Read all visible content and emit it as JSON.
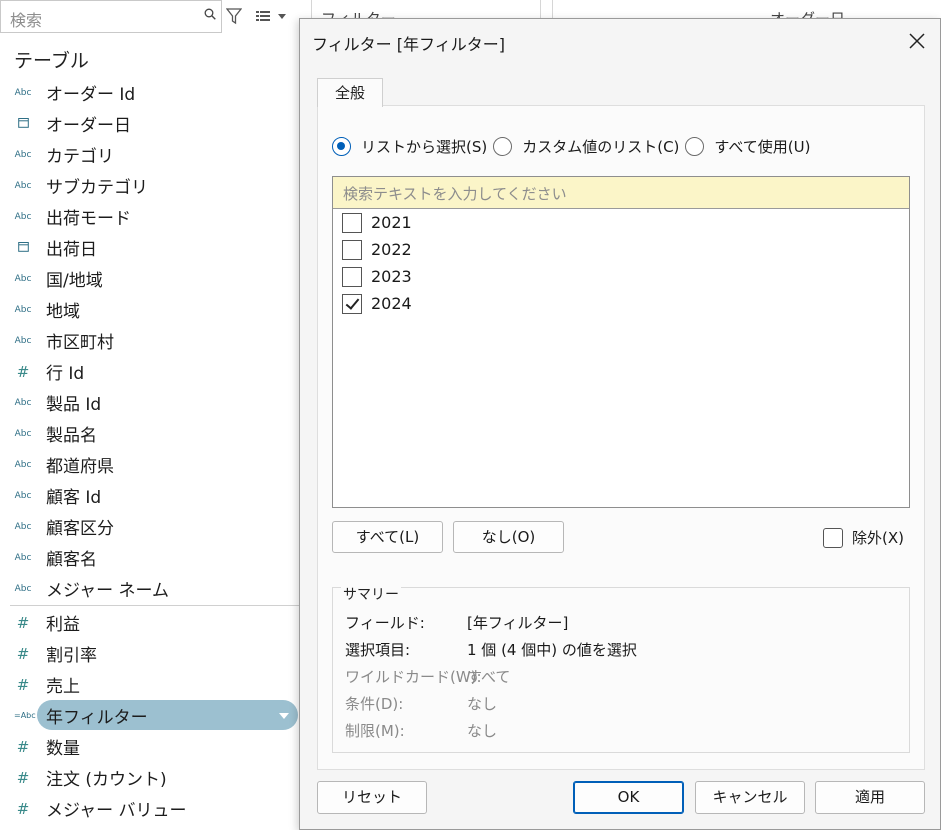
{
  "left_pane": {
    "search_placeholder": "検索",
    "tables_heading": "テーブル",
    "dimensions": [
      {
        "type": "Abc",
        "name": "オーダー Id"
      },
      {
        "type": "cal",
        "name": "オーダー日"
      },
      {
        "type": "Abc",
        "name": "カテゴリ"
      },
      {
        "type": "Abc",
        "name": "サブカテゴリ"
      },
      {
        "type": "Abc",
        "name": "出荷モード"
      },
      {
        "type": "cal",
        "name": "出荷日"
      },
      {
        "type": "Abc",
        "name": "国/地域"
      },
      {
        "type": "Abc",
        "name": "地域"
      },
      {
        "type": "Abc",
        "name": "市区町村"
      },
      {
        "type": "#",
        "name": "行 Id"
      },
      {
        "type": "Abc",
        "name": "製品 Id"
      },
      {
        "type": "Abc",
        "name": "製品名"
      },
      {
        "type": "Abc",
        "name": "都道府県"
      },
      {
        "type": "Abc",
        "name": "顧客 Id"
      },
      {
        "type": "Abc",
        "name": "顧客区分"
      },
      {
        "type": "Abc",
        "name": "顧客名"
      },
      {
        "type": "Abc",
        "name": "メジャー ネーム"
      }
    ],
    "measures": [
      {
        "type": "#",
        "name": "利益"
      },
      {
        "type": "#",
        "name": "割引率"
      },
      {
        "type": "#",
        "name": "売上"
      },
      {
        "type": "=Abc",
        "name": "年フィルター",
        "selected": true
      },
      {
        "type": "#",
        "name": "数量"
      },
      {
        "type": "#",
        "name": "注文 (カウント)"
      },
      {
        "type": "#",
        "name": "メジャー バリュー"
      }
    ]
  },
  "background": {
    "card1_title": "フィルター",
    "card2_title": "オーダー日"
  },
  "dialog": {
    "title": "フィルター [年フィルター]",
    "tab_general": "全般",
    "radio_list": "リストから選択(S)",
    "radio_custom": "カスタム値のリスト(C)",
    "radio_all": "すべて使用(U)",
    "search_placeholder": "検索テキストを入力してください",
    "items": [
      {
        "label": "2021",
        "checked": false
      },
      {
        "label": "2022",
        "checked": false
      },
      {
        "label": "2023",
        "checked": false
      },
      {
        "label": "2024",
        "checked": true
      }
    ],
    "btn_all": "すべて(L)",
    "btn_none": "なし(O)",
    "exclude_label": "除外(X)",
    "summary": {
      "title": "サマリー",
      "field_k": "フィールド:",
      "field_v": "[年フィルター]",
      "selection_k": "選択項目:",
      "selection_v": "1 個 (4 個中) の値を選択",
      "wildcard_k": "ワイルドカード(W):",
      "wildcard_v": "すべて",
      "condition_k": "条件(D):",
      "condition_v": "なし",
      "limit_k": "制限(M):",
      "limit_v": "なし"
    },
    "btn_reset": "リセット",
    "btn_ok": "OK",
    "btn_cancel": "キャンセル",
    "btn_apply": "適用"
  }
}
